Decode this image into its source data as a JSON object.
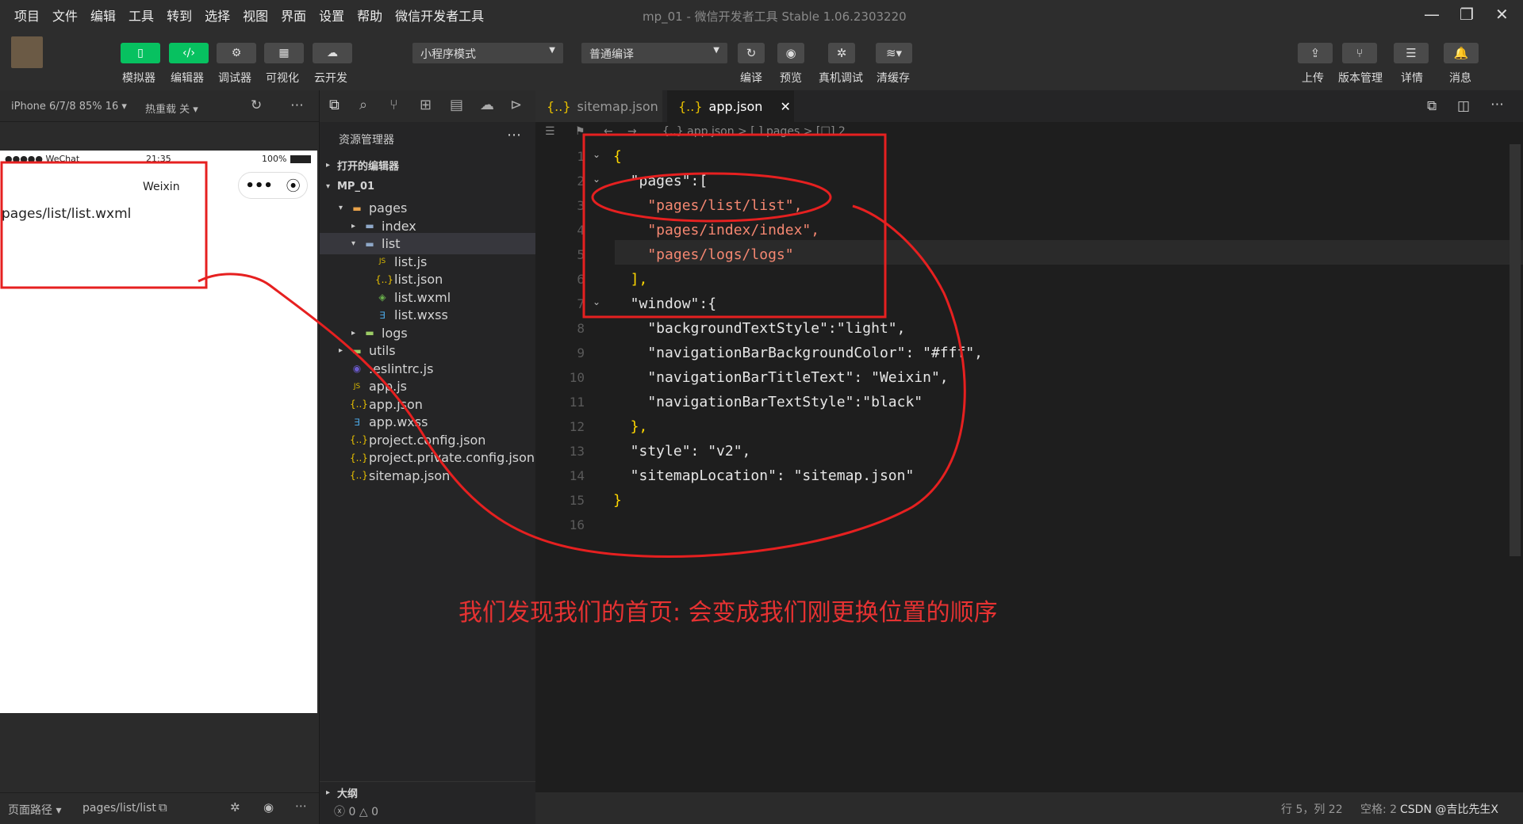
{
  "menubar": {
    "items": [
      "项目",
      "文件",
      "编辑",
      "工具",
      "转到",
      "选择",
      "视图",
      "界面",
      "设置",
      "帮助",
      "微信开发者工具"
    ],
    "window_title": "mp_01 - 微信开发者工具 Stable 1.06.2303220"
  },
  "toolbar": {
    "simulator": "模拟器",
    "editor": "编辑器",
    "debugger": "调试器",
    "visual": "可视化",
    "cloud": "云开发",
    "mode_select": "小程序模式",
    "compile_select": "普通编译",
    "compile": "编译",
    "preview": "预览",
    "device_debug": "真机调试",
    "clear_cache": "清缓存",
    "upload": "上传",
    "version": "版本管理",
    "details": "详情",
    "messages": "消息"
  },
  "simulator": {
    "device": "iPhone 6/7/8 85% 16 ▾",
    "hot_reload": "热重载 关 ▾",
    "carrier": "●●●●● WeChat",
    "time": "21:35",
    "battery": "100%",
    "nav_title": "Weixin",
    "page_text": "pages/list/list.wxml",
    "path_label": "页面路径 ▾",
    "path_value": "pages/list/list"
  },
  "explorer": {
    "title": "资源管理器",
    "open_editors": "打开的编辑器",
    "project": "MP_01",
    "outline": "大纲",
    "problems": "0",
    "warnings": "0",
    "tree": [
      {
        "label": "pages",
        "indent": 1,
        "arrow": "▾",
        "icon": "folder",
        "color": "#e8a24a"
      },
      {
        "label": "index",
        "indent": 2,
        "arrow": "▸",
        "icon": "folder",
        "color": "#8fa8c8"
      },
      {
        "label": "list",
        "indent": 2,
        "arrow": "▾",
        "icon": "folder",
        "color": "#8fa8c8",
        "selected": true
      },
      {
        "label": "list.js",
        "indent": 3,
        "arrow": "",
        "icon": "js",
        "color": "#d8b800"
      },
      {
        "label": "list.json",
        "indent": 3,
        "arrow": "",
        "icon": "json",
        "color": "#e8c000"
      },
      {
        "label": "list.wxml",
        "indent": 3,
        "arrow": "",
        "icon": "wxml",
        "color": "#6ab04c"
      },
      {
        "label": "list.wxss",
        "indent": 3,
        "arrow": "",
        "icon": "css",
        "color": "#4aa3df"
      },
      {
        "label": "logs",
        "indent": 2,
        "arrow": "▸",
        "icon": "folder",
        "color": "#9ccc65"
      },
      {
        "label": "utils",
        "indent": 1,
        "arrow": "▸",
        "icon": "folder",
        "color": "#9ccc65"
      },
      {
        "label": ".eslintrc.js",
        "indent": 1,
        "arrow": "",
        "icon": "eslint",
        "color": "#6a5acd"
      },
      {
        "label": "app.js",
        "indent": 1,
        "arrow": "",
        "icon": "js",
        "color": "#d8b800"
      },
      {
        "label": "app.json",
        "indent": 1,
        "arrow": "",
        "icon": "json",
        "color": "#e8c000"
      },
      {
        "label": "app.wxss",
        "indent": 1,
        "arrow": "",
        "icon": "css",
        "color": "#4aa3df"
      },
      {
        "label": "project.config.json",
        "indent": 1,
        "arrow": "",
        "icon": "json",
        "color": "#e8c000"
      },
      {
        "label": "project.private.config.json",
        "indent": 1,
        "arrow": "",
        "icon": "json",
        "color": "#e8c000"
      },
      {
        "label": "sitemap.json",
        "indent": 1,
        "arrow": "",
        "icon": "json",
        "color": "#e8c000"
      }
    ]
  },
  "editor": {
    "tabs": [
      {
        "label": "sitemap.json",
        "active": false
      },
      {
        "label": "app.json",
        "active": true
      }
    ],
    "breadcrumb": "{..} app.json > [ ] pages > [☐] 2",
    "lines": [
      {
        "n": "1",
        "text": "{"
      },
      {
        "n": "2",
        "text": "  \"pages\":["
      },
      {
        "n": "3",
        "text": "    \"pages/list/list\","
      },
      {
        "n": "4",
        "text": "    \"pages/index/index\","
      },
      {
        "n": "5",
        "text": "    \"pages/logs/logs\""
      },
      {
        "n": "6",
        "text": "  ],"
      },
      {
        "n": "7",
        "text": "  \"window\":{"
      },
      {
        "n": "8",
        "text": "    \"backgroundTextStyle\":\"light\","
      },
      {
        "n": "9",
        "text": "    \"navigationBarBackgroundColor\": \"#fff\","
      },
      {
        "n": "10",
        "text": "    \"navigationBarTitleText\": \"Weixin\","
      },
      {
        "n": "11",
        "text": "    \"navigationBarTextStyle\":\"black\""
      },
      {
        "n": "12",
        "text": "  },"
      },
      {
        "n": "13",
        "text": "  \"style\": \"v2\","
      },
      {
        "n": "14",
        "text": "  \"sitemapLocation\": \"sitemap.json\""
      },
      {
        "n": "15",
        "text": "}"
      },
      {
        "n": "16",
        "text": ""
      }
    ]
  },
  "statusbar": {
    "position": "行 5，列 22",
    "spaces": "空格: 2",
    "watermark": "CSDN @吉比先生X"
  },
  "annotation": "我们发现我们的首页: 会变成我们刚更换位置的顺序",
  "colors": {
    "accent_green": "#07c160",
    "annotation_red": "#e63232"
  }
}
